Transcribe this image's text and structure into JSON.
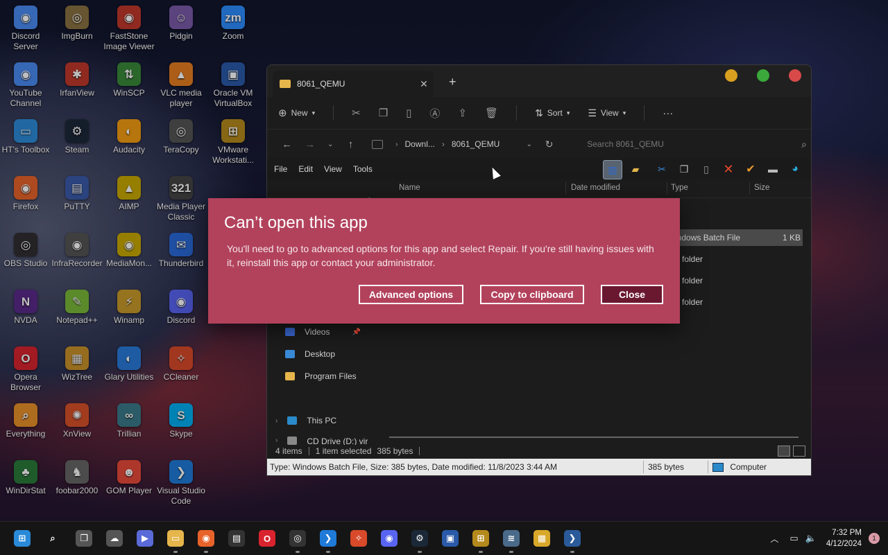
{
  "desktop": {
    "icons": [
      {
        "label": "Discord Server",
        "color": "#4a8bf2",
        "glyph": "◉"
      },
      {
        "label": "ImgBurn",
        "color": "#8a7040",
        "glyph": "◎"
      },
      {
        "label": "FastStone Image Viewer",
        "color": "#c0392b",
        "glyph": "◉"
      },
      {
        "label": "Pidgin",
        "color": "#7a5aa8",
        "glyph": "☺"
      },
      {
        "label": "Zoom",
        "color": "#2d8cff",
        "glyph": "zm"
      },
      {
        "label": "YouTube Channel",
        "color": "#4a8bf2",
        "glyph": "◉"
      },
      {
        "label": "IrfanView",
        "color": "#c0392b",
        "glyph": "✱"
      },
      {
        "label": "WinSCP",
        "color": "#3a8a3a",
        "glyph": "⇅"
      },
      {
        "label": "VLC media player",
        "color": "#e67e22",
        "glyph": "▲"
      },
      {
        "label": "Oracle VM VirtualBox",
        "color": "#2a5aa8",
        "glyph": "▣"
      },
      {
        "label": "HT's Toolbox",
        "color": "#2c8bd8",
        "glyph": "▭"
      },
      {
        "label": "Steam",
        "color": "#1b2838",
        "glyph": "⚙"
      },
      {
        "label": "Audacity",
        "color": "#f39c12",
        "glyph": "◐"
      },
      {
        "label": "TeraCopy",
        "color": "#555555",
        "glyph": "◎"
      },
      {
        "label": "VMware Workstati...",
        "color": "#b58a1c",
        "glyph": "⊞"
      },
      {
        "label": "Firefox",
        "color": "#e8632a",
        "glyph": "◉"
      },
      {
        "label": "PuTTY",
        "color": "#3a5aa8",
        "glyph": "▤"
      },
      {
        "label": "AIMP",
        "color": "#c8a800",
        "glyph": "▲"
      },
      {
        "label": "Media Player Classic",
        "color": "#444444",
        "glyph": "321"
      },
      {
        "label": "OBS Studio",
        "color": "#302e31",
        "glyph": "◎"
      },
      {
        "label": "InfraRecorder",
        "color": "#555555",
        "glyph": "◉"
      },
      {
        "label": "MediaMon...",
        "color": "#c8a800",
        "glyph": "◉"
      },
      {
        "label": "Thunderbird",
        "color": "#2a6ad8",
        "glyph": "✉"
      },
      {
        "label": "NVDA",
        "color": "#5a2a8a",
        "glyph": "N"
      },
      {
        "label": "Notepad++",
        "color": "#7ab83a",
        "glyph": "✎"
      },
      {
        "label": "Winamp",
        "color": "#c89a2a",
        "glyph": "⚡"
      },
      {
        "label": "Discord",
        "color": "#5865f2",
        "glyph": "◉"
      },
      {
        "label": "Opera Browser",
        "color": "#d9232e",
        "glyph": "O"
      },
      {
        "label": "WizTree",
        "color": "#c8902a",
        "glyph": "▦"
      },
      {
        "label": "Glary Utilities",
        "color": "#2a7ad8",
        "glyph": "◐"
      },
      {
        "label": "CCleaner",
        "color": "#d84a2a",
        "glyph": "✧"
      },
      {
        "label": "Everything",
        "color": "#e8902a",
        "glyph": "⌕"
      },
      {
        "label": "XnView",
        "color": "#d8502a",
        "glyph": "✺"
      },
      {
        "label": "Trillian",
        "color": "#3a7a8a",
        "glyph": "∞"
      },
      {
        "label": "Skype",
        "color": "#00aff0",
        "glyph": "S"
      },
      {
        "label": "WinDirStat",
        "color": "#2a7a3a",
        "glyph": "♣"
      },
      {
        "label": "foobar2000",
        "color": "#666666",
        "glyph": "♞"
      },
      {
        "label": "GOM Player",
        "color": "#e84a3a",
        "glyph": "☻"
      },
      {
        "label": "Visual Studio Code",
        "color": "#1f7ad8",
        "glyph": "❯"
      }
    ]
  },
  "explorer": {
    "tab_title": "8061_QEMU",
    "toolbar": {
      "new": "New",
      "sort": "Sort",
      "view": "View",
      "more": "···"
    },
    "breadcrumb": {
      "parent": "Downl...",
      "current": "8061_QEMU"
    },
    "search_placeholder": "Search 8061_QEMU",
    "menu": [
      "File",
      "Edit",
      "View",
      "Tools"
    ],
    "columns": {
      "name": "Name",
      "date": "Date modified",
      "type": "Type",
      "size": "Size"
    },
    "nav_pane": [
      {
        "label": "Videos",
        "color": "#3a6ad8",
        "pinned": true
      },
      {
        "label": "Desktop",
        "color": "#3a8ad8",
        "pinned": false
      },
      {
        "label": "Program Files",
        "color": "#e6b64c",
        "pinned": false
      },
      {
        "label": "This PC",
        "color": "#2b8ac9",
        "pinned": false
      },
      {
        "label": "CD Drive (D:) vir",
        "color": "#888888",
        "pinned": false
      }
    ],
    "files": [
      {
        "type": "indows Batch File",
        "size": "1 KB",
        "selected": true
      },
      {
        "type": "e folder",
        "size": "",
        "selected": false
      },
      {
        "type": "e folder",
        "size": "",
        "selected": false
      },
      {
        "type": "e folder",
        "size": "",
        "selected": false
      }
    ],
    "status": {
      "items": "4 items",
      "selected": "1 item selected",
      "bytes": "385 bytes"
    },
    "infobar": {
      "details": "Type: Windows Batch File, Size: 385 bytes, Date modified: 11/8/2023 3:44 AM",
      "size": "385 bytes",
      "location": "Computer"
    }
  },
  "dialog": {
    "title": "Can’t open this app",
    "message": "You'll need to go to advanced options for this app and select Repair. If you're still having issues with it, reinstall this app or contact your administrator.",
    "buttons": {
      "advanced": "Advanced options",
      "copy": "Copy to clipboard",
      "close": "Close"
    }
  },
  "taskbar": {
    "apps": [
      {
        "name": "start",
        "color": "#2a8ad8",
        "glyph": "⊞"
      },
      {
        "name": "search",
        "color": "#151515",
        "glyph": "⌕"
      },
      {
        "name": "task-view",
        "color": "#555555",
        "glyph": "❐"
      },
      {
        "name": "widgets",
        "color": "#555555",
        "glyph": "☁"
      },
      {
        "name": "camera",
        "color": "#5a6ad8",
        "glyph": "▶"
      },
      {
        "name": "file-explorer",
        "color": "#e6b64c",
        "glyph": "▭"
      },
      {
        "name": "firefox",
        "color": "#e8632a",
        "glyph": "◉"
      },
      {
        "name": "terminal",
        "color": "#333333",
        "glyph": "▤"
      },
      {
        "name": "opera",
        "color": "#d9232e",
        "glyph": "O"
      },
      {
        "name": "obs",
        "color": "#333333",
        "glyph": "◎"
      },
      {
        "name": "vscode",
        "color": "#1f7ad8",
        "glyph": "❯"
      },
      {
        "name": "ccleaner",
        "color": "#d84a2a",
        "glyph": "✧"
      },
      {
        "name": "discord",
        "color": "#5865f2",
        "glyph": "◉"
      },
      {
        "name": "steam",
        "color": "#1b2838",
        "glyph": "⚙"
      },
      {
        "name": "virtualbox",
        "color": "#2a5aa8",
        "glyph": "▣"
      },
      {
        "name": "vmware",
        "color": "#b58a1c",
        "glyph": "⊞"
      },
      {
        "name": "resource-monitor",
        "color": "#4a6a8a",
        "glyph": "≋"
      },
      {
        "name": "store",
        "color": "#d8a82a",
        "glyph": "▦"
      },
      {
        "name": "powershell",
        "color": "#2a5a9a",
        "glyph": "❯"
      }
    ],
    "time": "7:32 PM",
    "date": "4/12/2024",
    "notifications": "1"
  }
}
